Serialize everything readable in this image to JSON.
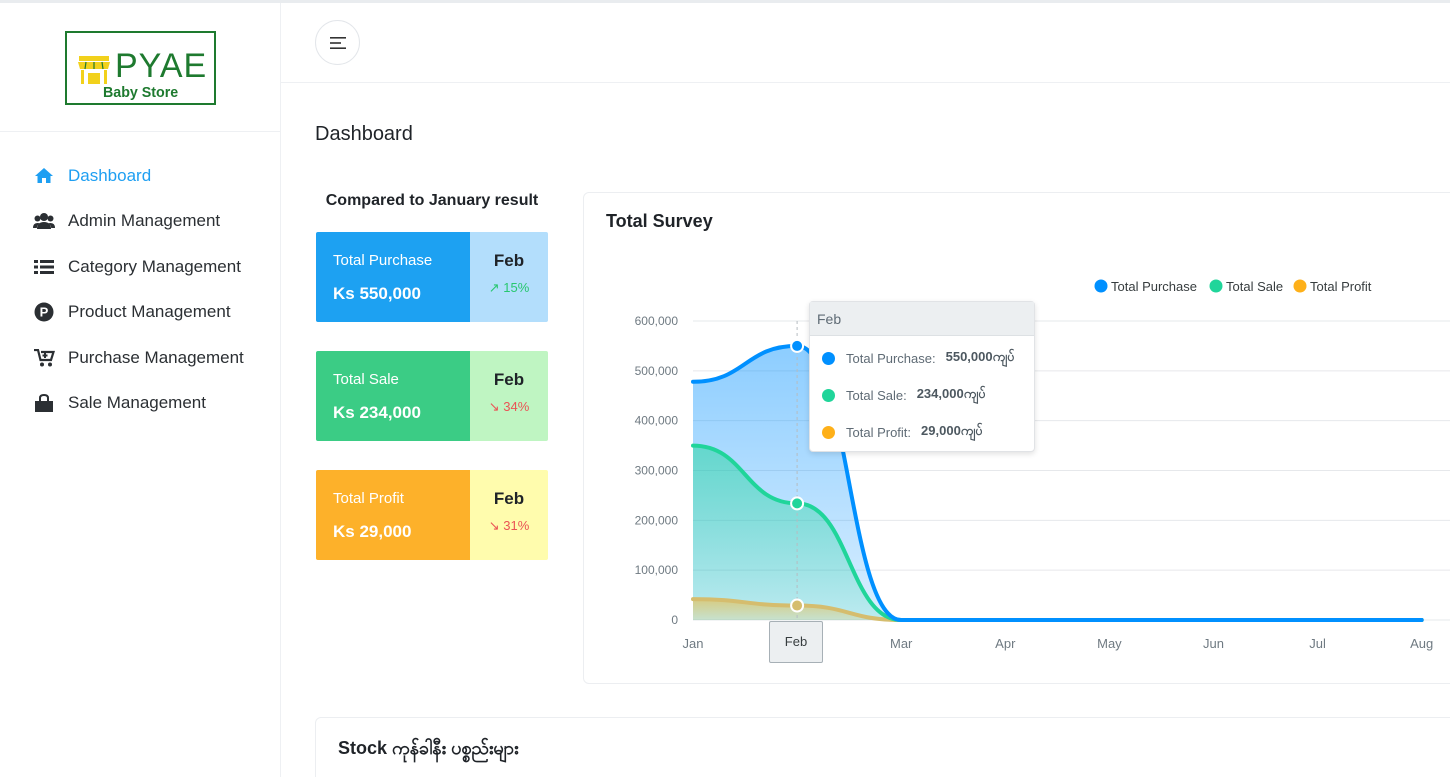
{
  "brand": {
    "name": "PYAE",
    "tagline": "Baby Store",
    "color": "#1e7a2f"
  },
  "sidebar": {
    "items": [
      {
        "label": "Dashboard",
        "icon": "home-icon",
        "active": true
      },
      {
        "label": "Admin Management",
        "icon": "users-icon",
        "active": false
      },
      {
        "label": "Category Management",
        "icon": "list-icon",
        "active": false
      },
      {
        "label": "Product Management",
        "icon": "product-p-icon",
        "active": false
      },
      {
        "label": "Purchase Management",
        "icon": "cart-icon",
        "active": false
      },
      {
        "label": "Sale Management",
        "icon": "shopping-bag-icon",
        "active": false
      }
    ]
  },
  "header": {
    "menu_icon": "hamburger-icon"
  },
  "page": {
    "title": "Dashboard"
  },
  "compare": {
    "title": "Compared to January result",
    "cards": [
      {
        "name": "Total Purchase",
        "value": "Ks 550,000",
        "month": "Feb",
        "change": "15%",
        "direction": "up",
        "color": "#1da1f2"
      },
      {
        "name": "Total Sale",
        "value": "Ks 234,000",
        "month": "Feb",
        "change": "34%",
        "direction": "down",
        "color": "#3bcc85"
      },
      {
        "name": "Total Profit",
        "value": "Ks 29,000",
        "month": "Feb",
        "change": "31%",
        "direction": "down",
        "color": "#fdb12a"
      }
    ]
  },
  "survey": {
    "title": "Total Survey",
    "tooltip": {
      "header": "Feb",
      "rows": [
        {
          "label": "Total Purchase:",
          "value": "550,000ကျပ်"
        },
        {
          "label": "Total Sale:",
          "value": "234,000ကျပ်"
        },
        {
          "label": "Total Profit:",
          "value": "29,000ကျပ်"
        }
      ]
    },
    "x_badge": "Feb"
  },
  "chart_data": {
    "type": "area",
    "title": "Total Survey",
    "categories": [
      "Jan",
      "Feb",
      "Mar",
      "Apr",
      "May",
      "Jun",
      "Jul",
      "Aug"
    ],
    "series": [
      {
        "name": "Total Purchase",
        "color": "#0090ff",
        "values": [
          478000,
          550000,
          0,
          0,
          0,
          0,
          0,
          0
        ]
      },
      {
        "name": "Total Sale",
        "color": "#20d59a",
        "values": [
          350000,
          234000,
          0,
          0,
          0,
          0,
          0,
          0
        ]
      },
      {
        "name": "Total Profit",
        "color": "#feb019",
        "values": [
          42000,
          29000,
          0,
          0,
          0,
          0,
          0,
          0
        ]
      }
    ],
    "yticks": [
      "0",
      "100,000",
      "200,000",
      "300,000",
      "400,000",
      "500,000",
      "600,000"
    ],
    "ylim": [
      0,
      600000
    ],
    "grid": true,
    "legend": "top-right"
  },
  "stock": {
    "title": "Stock ကုန်ခါနီး ပစ္စည်းများ"
  }
}
